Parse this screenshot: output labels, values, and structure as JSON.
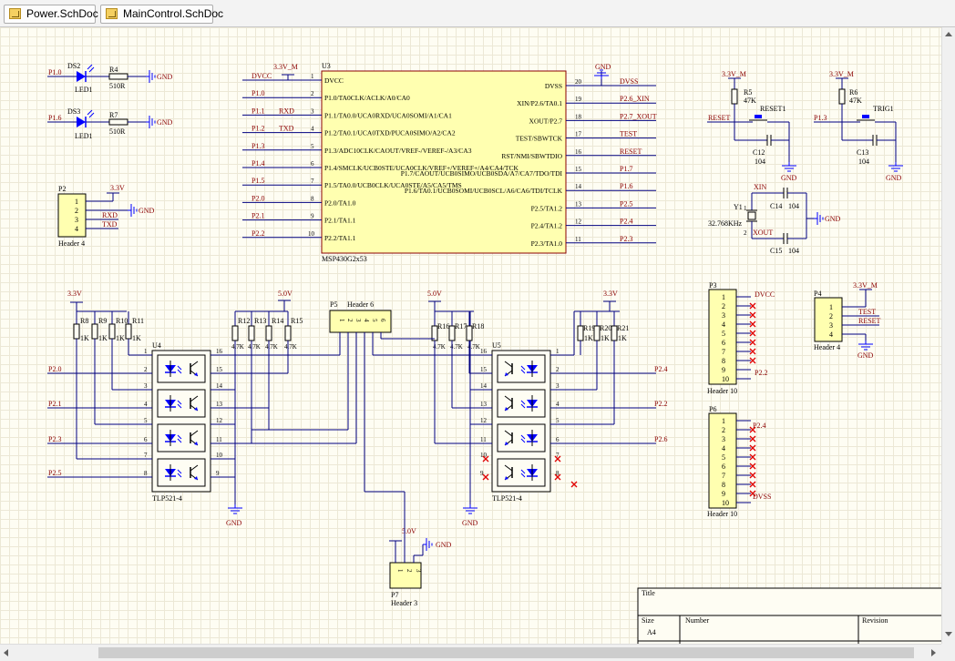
{
  "tabs": [
    {
      "label": "Power.SchDoc"
    },
    {
      "label": "MainControl.SchDoc"
    }
  ],
  "leds": {
    "ds2": {
      "ref": "DS2",
      "val": "LED1",
      "net": "P1.0",
      "r": "R4",
      "rv": "510R",
      "gnd": "GND"
    },
    "ds3": {
      "ref": "DS3",
      "val": "LED1",
      "net": "P1.6",
      "r": "R7",
      "rv": "510R",
      "gnd": "GND"
    }
  },
  "p2": {
    "ref": "P2",
    "val": "Header 4",
    "pwr": "3.3V",
    "gnd": "GND",
    "pins": [
      "1",
      "2",
      "3",
      "4"
    ],
    "nets": [
      "RXD",
      "TXD"
    ]
  },
  "u3": {
    "ref": "U3",
    "val": "MSP430G2x53",
    "pwr": "3.3V_M",
    "gnd": "GND",
    "left": [
      {
        "net": "DVCC",
        "num": "1",
        "name": "DVCC"
      },
      {
        "net": "P1.0",
        "num": "2",
        "name": "P1.0/TA0CLK/ACLK/A0/CA0"
      },
      {
        "net": "P1.1",
        "alias": "RXD",
        "num": "3",
        "name": "P1.1/TA0.0/UCA0RXD/UCA0SOMI/A1/CA1"
      },
      {
        "net": "P1.2",
        "alias": "TXD",
        "num": "4",
        "name": "P1.2/TA0.1/UCA0TXD/PUCA0SIMO/A2/CA2"
      },
      {
        "net": "P1.3",
        "num": "5",
        "name": "P1.3/ADC10CLK/CAOUT/VREF-/VEREF-/A3/CA3"
      },
      {
        "net": "P1.4",
        "num": "6",
        "name": "P1.4/SMCLK/UCB0STE/UCA0CLK/VREF+/VEREF+/A4/CA4/TCK"
      },
      {
        "net": "P1.5",
        "num": "7",
        "name": "P1.5/TA0.0/UCB0CLK/UCA0STE/A5/CA5/TMS"
      },
      {
        "net": "P2.0",
        "num": "8",
        "name": "P2.0/TA1.0"
      },
      {
        "net": "P2.1",
        "num": "9",
        "name": "P2.1/TA1.1"
      },
      {
        "net": "P2.2",
        "num": "10",
        "name": "P2.2/TA1.1"
      }
    ],
    "right": [
      {
        "num": "20",
        "name": "DVSS",
        "net": "DVSS"
      },
      {
        "num": "19",
        "name": "XIN/P2.6/TA0.1",
        "net": "P2.6_XIN"
      },
      {
        "num": "18",
        "name": "XOUT/P2.7",
        "net": "P2.7_XOUT"
      },
      {
        "num": "17",
        "name": "TEST/SBWTCK",
        "net": "TEST"
      },
      {
        "num": "16",
        "name": "RST/NMI/SBWTDIO",
        "net": "RESET"
      },
      {
        "num": "15",
        "name": "P1.7/CAOUT/UCB0SIMO/UCB0SDA/A7/CA7/TDO/TDI",
        "net": "P1.7"
      },
      {
        "num": "14",
        "name": "P1.6/TA0.1/UCB0SOMI/UCB0SCL/A6/CA6/TDI/TCLK",
        "net": "P1.6"
      },
      {
        "num": "13",
        "name": "P2.5/TA1.2",
        "net": "P2.5"
      },
      {
        "num": "12",
        "name": "P2.4/TA1.2",
        "net": "P2.4"
      },
      {
        "num": "11",
        "name": "P2.3/TA1.0",
        "net": "P2.3"
      }
    ]
  },
  "reset": {
    "pwr": "3.3V_M",
    "r": "R5",
    "rv": "47K",
    "net": "RESET",
    "sw": "RESET1",
    "c": "C12",
    "cv": "104",
    "gnd": "GND"
  },
  "trig": {
    "pwr": "3.3V_M",
    "r": "R6",
    "rv": "47K",
    "net": "P1.3",
    "sw": "TRIG1",
    "c": "C13",
    "cv": "104",
    "gnd": "GND"
  },
  "crystal": {
    "xin": "XIN",
    "xout": "XOUT",
    "y": "Y1",
    "yv": "32.768KHz",
    "c1": "C14",
    "c1v": "104",
    "c2": "C15",
    "c2v": "104",
    "gnd": "GND",
    "pin1": "1",
    "pin2": "2"
  },
  "p3": {
    "ref": "P3",
    "val": "Header 10",
    "pins": [
      "1",
      "2",
      "3",
      "4",
      "5",
      "6",
      "7",
      "8",
      "9",
      "10"
    ],
    "n1": "DVCC",
    "n9": "P2.2"
  },
  "p4": {
    "ref": "P4",
    "val": "Header 4",
    "pwr": "3.3V_M",
    "pins": [
      "1",
      "2",
      "3",
      "4"
    ],
    "n2": "TEST",
    "n3": "RESET",
    "gnd": "GND"
  },
  "p6": {
    "ref": "P6",
    "val": "Header 10",
    "pins": [
      "1",
      "2",
      "3",
      "4",
      "5",
      "6",
      "7",
      "8",
      "9",
      "10"
    ],
    "n1": "P2.4",
    "n10": "DVSS"
  },
  "p5": {
    "ref": "P5",
    "val": "Header 6",
    "pins": [
      "1",
      "2",
      "3",
      "4",
      "5",
      "6"
    ]
  },
  "p7": {
    "ref": "P7",
    "val": "Header 3",
    "pwr": "5.0V",
    "gnd": "GND",
    "pins": [
      "1",
      "2",
      "3"
    ]
  },
  "u4": {
    "ref": "U4",
    "val": "TLP521-4",
    "pwr": "3.3V",
    "pwr2": "5.0V",
    "gnd": "GND",
    "rl": [
      {
        "ref": "R8",
        "v": "1K"
      },
      {
        "ref": "R9",
        "v": "1K"
      },
      {
        "ref": "R10",
        "v": "1K"
      },
      {
        "ref": "R11",
        "v": "1K"
      }
    ],
    "rr": [
      {
        "ref": "R12",
        "v": "4.7K"
      },
      {
        "ref": "R13",
        "v": "4.7K"
      },
      {
        "ref": "R14",
        "v": "4.7K"
      },
      {
        "ref": "R15",
        "v": "4.7K"
      }
    ],
    "lpins": [
      "1",
      "2",
      "3",
      "4",
      "5",
      "6",
      "7",
      "8"
    ],
    "rpins": [
      "16",
      "15",
      "14",
      "13",
      "12",
      "11",
      "10",
      "9"
    ],
    "nets": [
      "P2.0",
      "P2.1",
      "P2.3",
      "P2.5"
    ]
  },
  "u5": {
    "ref": "U5",
    "val": "TLP521-4",
    "pwr": "5.0V",
    "pwr2": "3.3V",
    "gnd": "GND",
    "rl": [
      {
        "ref": "R16",
        "v": "4.7K"
      },
      {
        "ref": "R17",
        "v": "4.7K"
      },
      {
        "ref": "R18",
        "v": "4.7K"
      }
    ],
    "rr": [
      {
        "ref": "R19",
        "v": "1K"
      },
      {
        "ref": "R20",
        "v": "1K"
      },
      {
        "ref": "R21",
        "v": "1K"
      }
    ],
    "lpins": [
      "16",
      "15",
      "14",
      "13",
      "12",
      "11",
      "10",
      "9"
    ],
    "rpins": [
      "1",
      "2",
      "3",
      "4",
      "5",
      "6",
      "7",
      "8"
    ],
    "nets": [
      "P2.4",
      "P2.2",
      "P2.6"
    ]
  },
  "title_block": {
    "title": "Title",
    "size": "Size",
    "size_val": "A4",
    "number": "Number",
    "revision": "Revision"
  }
}
